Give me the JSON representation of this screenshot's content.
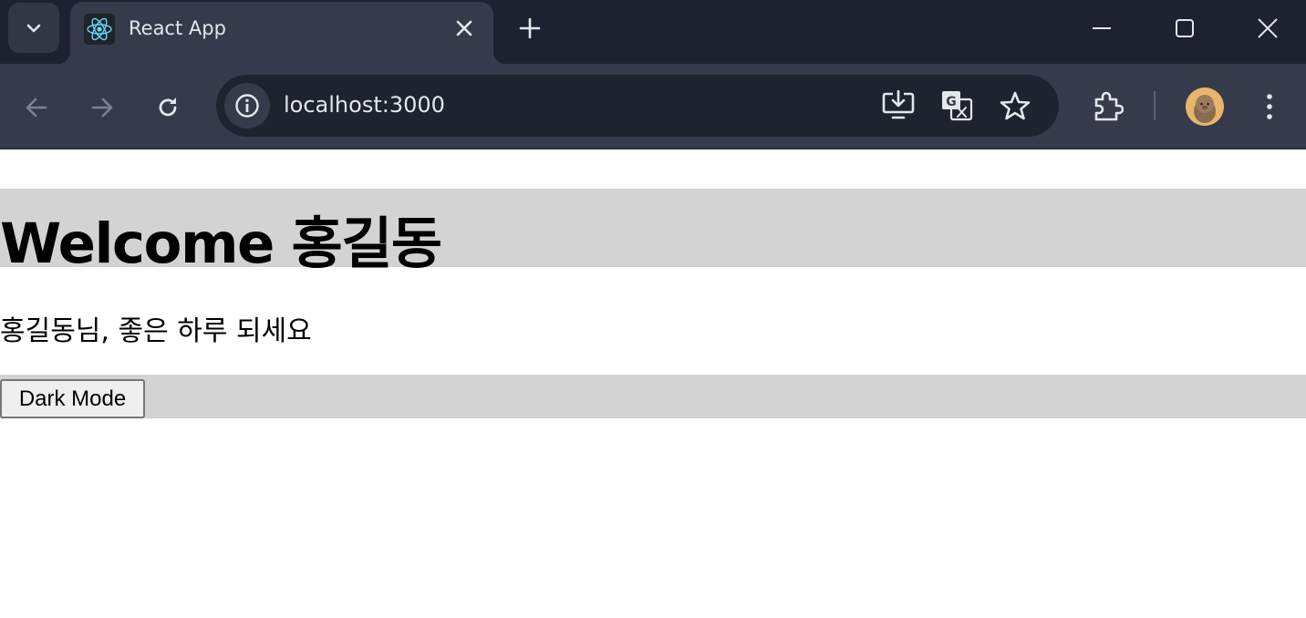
{
  "browser": {
    "tab": {
      "title": "React App",
      "favicon": "react-logo-icon"
    },
    "address_bar": {
      "url": "localhost:3000"
    },
    "icons": {
      "tab_search": "chevron-down-icon",
      "tab_close": "close-icon",
      "new_tab": "plus-icon",
      "minimize": "minimize-icon",
      "maximize": "maximize-icon",
      "close": "close-icon",
      "back": "back-arrow-icon",
      "forward": "forward-arrow-icon",
      "reload": "reload-icon",
      "site_info": "info-icon",
      "install": "install-app-icon",
      "translate": "translate-icon",
      "bookmark": "star-icon",
      "extensions": "puzzle-icon",
      "profile": "avatar",
      "menu": "kebab-menu-icon"
    },
    "colors": {
      "tabstrip": "#1e2230",
      "toolbar": "#353b4a",
      "omnibox": "#1f2330"
    }
  },
  "page": {
    "heading": "Welcome 홍길동",
    "greeting": "홍길동님, 좋은 하루 되세요",
    "button_label": "Dark Mode",
    "colors": {
      "bar_background": "#d3d3d3",
      "page_background": "#ffffff"
    }
  }
}
